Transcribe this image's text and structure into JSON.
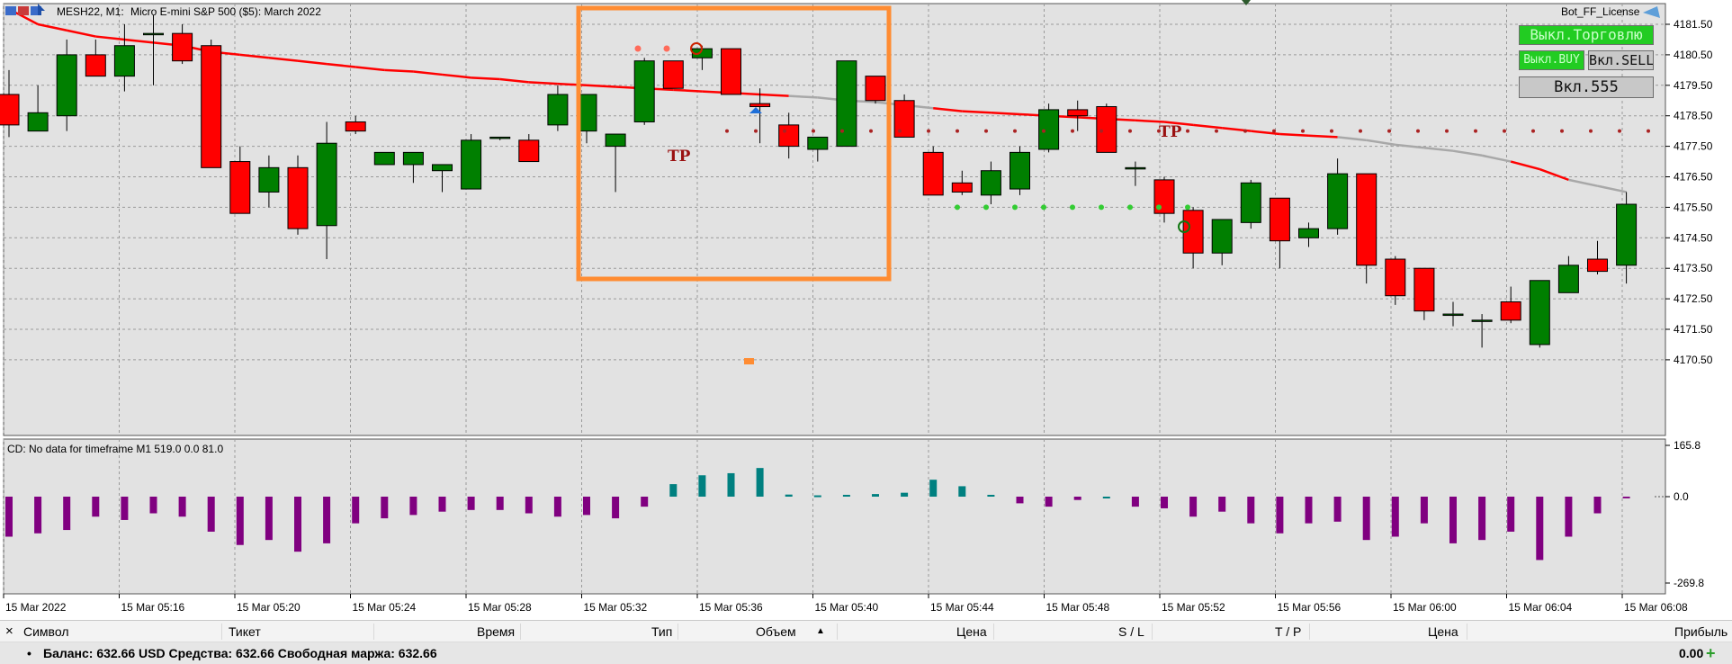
{
  "chart_header": {
    "symbol_timeframe": "MESH22, M1:",
    "description": "Micro E-mini S&P 500 ($5): March 2022",
    "license_label": "Bot_FF_License"
  },
  "price_axis": {
    "labels": [
      "4181.50",
      "4180.50",
      "4179.50",
      "4178.50",
      "4177.50",
      "4176.50",
      "4175.50",
      "4174.50",
      "4173.50",
      "4172.50",
      "4171.50",
      "4170.50"
    ]
  },
  "indicator_panel": {
    "title": "CD: No data for timeframe M1 519.0 0.0 81.0",
    "axis_labels": [
      "165.8",
      "0.0",
      "-269.8"
    ]
  },
  "time_axis": {
    "labels": [
      "15 Mar 2022",
      "15 Mar 05:16",
      "15 Mar 05:20",
      "15 Mar 05:24",
      "15 Mar 05:28",
      "15 Mar 05:32",
      "15 Mar 05:36",
      "15 Mar 05:40",
      "15 Mar 05:44",
      "15 Mar 05:48",
      "15 Mar 05:52",
      "15 Mar 05:56",
      "15 Mar 06:00",
      "15 Mar 06:04",
      "15 Mar 06:08"
    ]
  },
  "bot_panel": {
    "trading_toggle": "Выкл.Торговлю",
    "buy_toggle": "Выкл.BUY",
    "sell_toggle": "Вкл.SELL",
    "mode_toggle": "Вкл.555"
  },
  "chart_labels": {
    "tp_label": "TP"
  },
  "terminal": {
    "close_symbol": "×",
    "columns": {
      "symbol": "Символ",
      "ticket": "Тикет",
      "time": "Время",
      "type": "Тип",
      "volume": "Объем",
      "volume_sort": "▲",
      "price_open": "Цена",
      "sl": "S / L",
      "tp": "T / P",
      "price_current": "Цена",
      "profit": "Прибыль"
    },
    "summary": {
      "bullet": "•",
      "text": "Баланс: 632.66 USD  Средства: 632.66  Свободная маржа: 632.66",
      "profit": "0.00",
      "add_symbol": "+"
    }
  },
  "colors": {
    "chart_bg": "#e2e2e2",
    "bull": "#007f00",
    "bear": "#ff0000",
    "ma_line": "#ff0000",
    "ma_line_tail": "#a8a8a8",
    "histogram_positive": "#008080",
    "histogram_negative": "#800080",
    "highlight_box": "#ff8c32",
    "button_green": "#22cc22"
  },
  "chart_data": {
    "type": "candlestick",
    "y_range": [
      4170.0,
      4182.0
    ],
    "candles": [
      {
        "o": 4179.2,
        "h": 4180.0,
        "l": 4177.8,
        "c": 4178.2
      },
      {
        "o": 4178.0,
        "h": 4179.5,
        "l": 4178.0,
        "c": 4178.6
      },
      {
        "o": 4178.5,
        "h": 4181.0,
        "l": 4178.0,
        "c": 4180.5
      },
      {
        "o": 4180.5,
        "h": 4181.0,
        "l": 4179.8,
        "c": 4179.8
      },
      {
        "o": 4179.8,
        "h": 4181.5,
        "l": 4179.3,
        "c": 4180.8
      },
      {
        "o": 4181.2,
        "h": 4181.8,
        "l": 4179.5,
        "c": 4181.2
      },
      {
        "o": 4181.2,
        "h": 4181.5,
        "l": 4180.2,
        "c": 4180.3
      },
      {
        "o": 4180.8,
        "h": 4181.0,
        "l": 4176.8,
        "c": 4176.8
      },
      {
        "o": 4177.0,
        "h": 4177.5,
        "l": 4175.3,
        "c": 4175.3
      },
      {
        "o": 4176.0,
        "h": 4177.2,
        "l": 4175.5,
        "c": 4176.8
      },
      {
        "o": 4176.8,
        "h": 4177.2,
        "l": 4174.6,
        "c": 4174.8
      },
      {
        "o": 4174.9,
        "h": 4178.3,
        "l": 4173.8,
        "c": 4177.6
      },
      {
        "o": 4178.3,
        "h": 4178.5,
        "l": 4177.9,
        "c": 4178.0
      },
      {
        "o": 4176.9,
        "h": 4177.3,
        "l": 4176.9,
        "c": 4177.3
      },
      {
        "o": 4176.9,
        "h": 4177.0,
        "l": 4176.3,
        "c": 4177.3
      },
      {
        "o": 4176.7,
        "h": 4176.9,
        "l": 4176.0,
        "c": 4176.9
      },
      {
        "o": 4176.1,
        "h": 4177.9,
        "l": 4176.1,
        "c": 4177.7
      },
      {
        "o": 4177.8,
        "h": 4177.8,
        "l": 4177.7,
        "c": 4177.8
      },
      {
        "o": 4177.7,
        "h": 4177.9,
        "l": 4177.0,
        "c": 4177.0
      },
      {
        "o": 4178.2,
        "h": 4179.5,
        "l": 4178.0,
        "c": 4179.2
      },
      {
        "o": 4178.0,
        "h": 4179.0,
        "l": 4177.6,
        "c": 4179.2
      },
      {
        "o": 4177.5,
        "h": 4177.9,
        "l": 4176.0,
        "c": 4177.9
      },
      {
        "o": 4178.3,
        "h": 4180.4,
        "l": 4178.2,
        "c": 4180.3
      },
      {
        "o": 4180.3,
        "h": 4180.3,
        "l": 4179.4,
        "c": 4179.4
      },
      {
        "o": 4180.4,
        "h": 4180.8,
        "l": 4180.0,
        "c": 4180.7
      },
      {
        "o": 4180.7,
        "h": 4180.7,
        "l": 4179.2,
        "c": 4179.2
      },
      {
        "o": 4178.9,
        "h": 4179.4,
        "l": 4177.6,
        "c": 4178.8
      },
      {
        "o": 4178.2,
        "h": 4178.6,
        "l": 4177.1,
        "c": 4177.5
      },
      {
        "o": 4177.4,
        "h": 4177.5,
        "l": 4177.0,
        "c": 4177.8
      },
      {
        "o": 4177.5,
        "h": 4179.5,
        "l": 4177.5,
        "c": 4180.3
      },
      {
        "o": 4179.8,
        "h": 4179.8,
        "l": 4178.9,
        "c": 4179.0
      },
      {
        "o": 4179.0,
        "h": 4179.2,
        "l": 4177.8,
        "c": 4177.8
      },
      {
        "o": 4177.3,
        "h": 4177.5,
        "l": 4175.9,
        "c": 4175.9
      },
      {
        "o": 4176.3,
        "h": 4176.7,
        "l": 4175.9,
        "c": 4176.0
      },
      {
        "o": 4175.9,
        "h": 4177.0,
        "l": 4175.6,
        "c": 4176.7
      },
      {
        "o": 4176.1,
        "h": 4177.5,
        "l": 4175.9,
        "c": 4177.3
      },
      {
        "o": 4177.4,
        "h": 4178.9,
        "l": 4177.3,
        "c": 4178.7
      },
      {
        "o": 4178.7,
        "h": 4179.0,
        "l": 4178.0,
        "c": 4178.5
      },
      {
        "o": 4178.8,
        "h": 4178.9,
        "l": 4177.3,
        "c": 4177.3
      },
      {
        "o": 4176.8,
        "h": 4177.0,
        "l": 4176.2,
        "c": 4176.8
      },
      {
        "o": 4176.4,
        "h": 4176.5,
        "l": 4175.0,
        "c": 4175.3
      },
      {
        "o": 4175.4,
        "h": 4175.5,
        "l": 4173.5,
        "c": 4174.0
      },
      {
        "o": 4174.0,
        "h": 4175.0,
        "l": 4173.6,
        "c": 4175.1
      },
      {
        "o": 4175.0,
        "h": 4176.4,
        "l": 4174.8,
        "c": 4176.3
      },
      {
        "o": 4175.8,
        "h": 4175.8,
        "l": 4173.5,
        "c": 4174.4
      },
      {
        "o": 4174.5,
        "h": 4175.0,
        "l": 4174.2,
        "c": 4174.8
      },
      {
        "o": 4174.8,
        "h": 4177.1,
        "l": 4174.6,
        "c": 4176.6
      },
      {
        "o": 4176.6,
        "h": 4176.6,
        "l": 4173.0,
        "c": 4173.6
      },
      {
        "o": 4173.8,
        "h": 4173.9,
        "l": 4172.3,
        "c": 4172.6
      },
      {
        "o": 4173.5,
        "h": 4173.5,
        "l": 4171.8,
        "c": 4172.1
      },
      {
        "o": 4172.0,
        "h": 4172.4,
        "l": 4171.6,
        "c": 4172.0
      },
      {
        "o": 4171.8,
        "h": 4172.0,
        "l": 4170.9,
        "c": 4171.8
      },
      {
        "o": 4172.4,
        "h": 4172.9,
        "l": 4171.7,
        "c": 4171.8
      },
      {
        "o": 4171.0,
        "h": 4173.1,
        "l": 4170.9,
        "c": 4173.1
      },
      {
        "o": 4172.7,
        "h": 4173.9,
        "l": 4172.7,
        "c": 4173.6
      },
      {
        "o": 4173.8,
        "h": 4174.4,
        "l": 4173.3,
        "c": 4173.4
      },
      {
        "o": 4173.6,
        "h": 4176.0,
        "l": 4173.0,
        "c": 4175.6
      }
    ],
    "moving_average": [
      4182.0,
      4181.5,
      4181.3,
      4181.1,
      4181.0,
      4180.9,
      4180.8,
      4180.6,
      4180.5,
      4180.4,
      4180.3,
      4180.2,
      4180.1,
      4180.0,
      4179.95,
      4179.85,
      4179.75,
      4179.7,
      4179.6,
      4179.55,
      4179.5,
      4179.45,
      4179.4,
      4179.35,
      4179.3,
      4179.25,
      4179.2,
      4179.15,
      4179.1,
      4179.0,
      4178.95,
      4178.85,
      4178.75,
      4178.65,
      4178.6,
      4178.55,
      4178.5,
      4178.45,
      4178.4,
      4178.35,
      4178.3,
      4178.2,
      4178.1,
      4178.0,
      4177.9,
      4177.85,
      4177.8,
      4177.7,
      4177.55,
      4177.45,
      4177.35,
      4177.2,
      4177.0,
      4176.75,
      4176.4,
      4176.2,
      4176.0
    ],
    "histogram": [
      -120,
      -110,
      -100,
      -60,
      -70,
      -50,
      -60,
      -105,
      -145,
      -130,
      -165,
      -140,
      -80,
      -65,
      -55,
      -45,
      -40,
      -40,
      -50,
      -60,
      -55,
      -65,
      -30,
      48,
      82,
      90,
      110,
      8,
      5,
      7,
      10,
      15,
      65,
      40,
      7,
      -20,
      -30,
      -10,
      0,
      -30,
      -35,
      -60,
      -45,
      -80,
      -110,
      -80,
      -75,
      -130,
      -120,
      -80,
      -140,
      -130,
      -105,
      -190,
      -120,
      -50,
      -5
    ],
    "indicator_range": [
      -269.8,
      165.8
    ],
    "tp_levels": [
      4178.0,
      4175.5
    ],
    "pending_order_price": 4171.5,
    "ma_gray_segments": [
      [
        27,
        32
      ],
      [
        46,
        52
      ],
      [
        54,
        57
      ]
    ]
  }
}
